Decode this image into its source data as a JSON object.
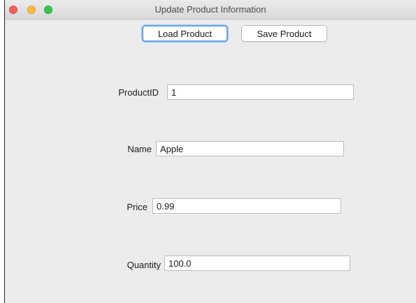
{
  "window": {
    "title": "Update Product Information"
  },
  "toolbar": {
    "load_label": "Load Product",
    "save_label": "Save Product"
  },
  "form": {
    "product_id": {
      "label": "ProductID",
      "value": "1"
    },
    "name": {
      "label": "Name",
      "value": "Apple"
    },
    "price": {
      "label": "Price",
      "value": "0.99"
    },
    "quantity": {
      "label": "Quantity",
      "value": "100.0"
    }
  },
  "colors": {
    "close": "#fc605b",
    "minimize": "#fdbc40",
    "maximize": "#34c84a",
    "focus_ring": "#6aa3e8",
    "window_bg": "#ececec"
  }
}
